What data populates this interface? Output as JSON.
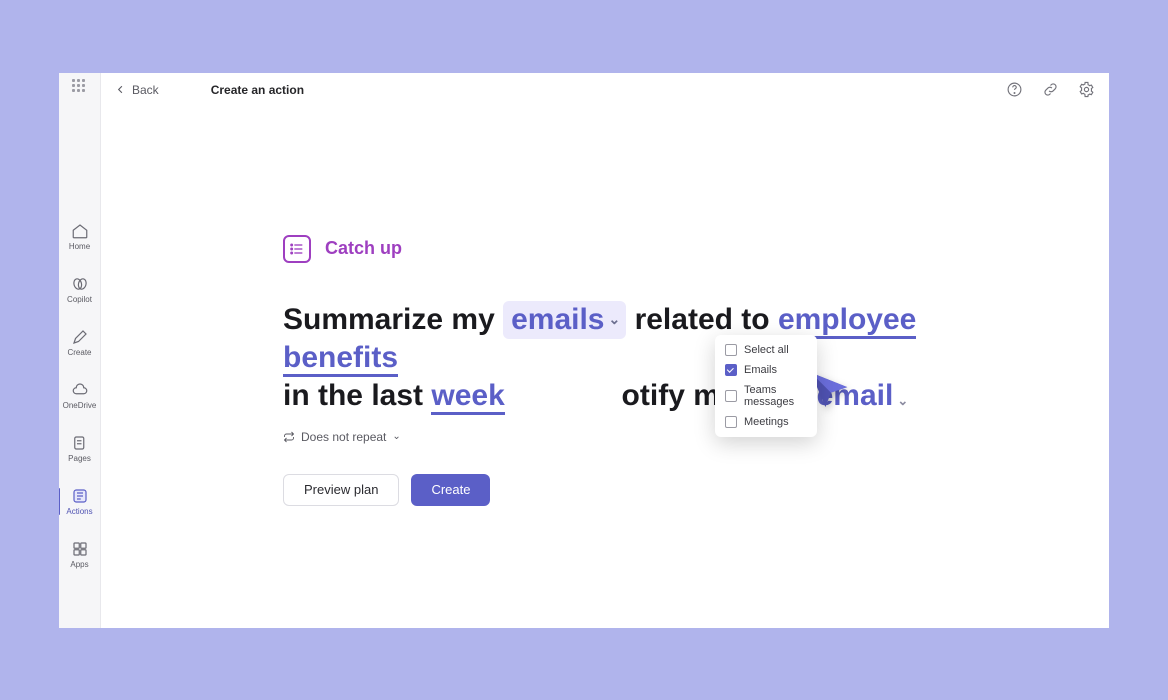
{
  "header": {
    "back_label": "Back",
    "title": "Create an action"
  },
  "sidebar": {
    "items": [
      {
        "label": "Home"
      },
      {
        "label": "Copilot"
      },
      {
        "label": "Create"
      },
      {
        "label": "OneDrive"
      },
      {
        "label": "Pages"
      },
      {
        "label": "Actions"
      },
      {
        "label": "Apps"
      }
    ]
  },
  "catchup": {
    "label": "Catch up"
  },
  "sentence": {
    "part1": "Summarize my ",
    "token_emails": "emails",
    "part2": " related to ",
    "token_topic": "employee benefits",
    "part3": "in the last ",
    "token_period": "week",
    "part4": "otify me over ",
    "token_channel": "email"
  },
  "repeat": {
    "label": "Does not repeat"
  },
  "buttons": {
    "preview": "Preview plan",
    "create": "Create"
  },
  "dropdown": {
    "items": [
      {
        "label": "Select all",
        "checked": false
      },
      {
        "label": "Emails",
        "checked": true
      },
      {
        "label": "Teams messages",
        "checked": false
      },
      {
        "label": "Meetings",
        "checked": false
      }
    ]
  }
}
